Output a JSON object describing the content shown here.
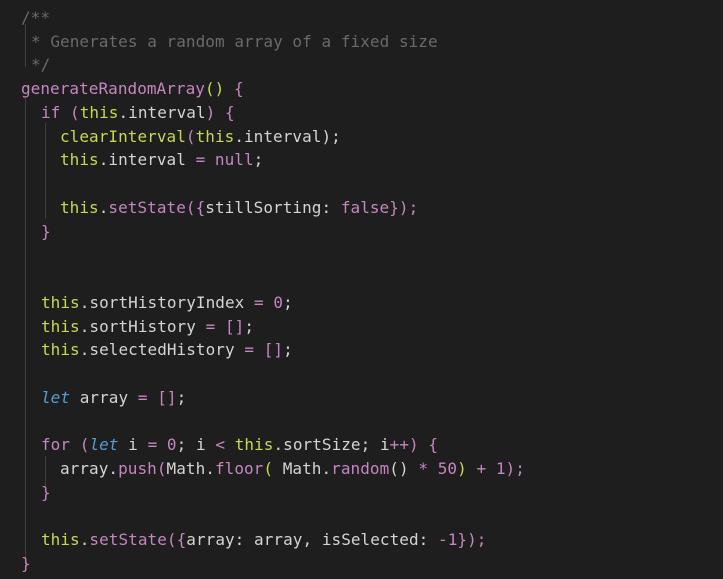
{
  "code": {
    "l1": "/**",
    "l2": "* Generates a random array of a fixed size",
    "l3": "*/",
    "l4_name": "generateRandomArray",
    "l4_parens": "()",
    "l4_brace": " {",
    "l5_if": "if",
    "l5_open": " (",
    "l5_this": "this",
    "l5_dot": ".interval",
    "l5_close": ")",
    "l5_brace": " {",
    "l6_call": "clearInterval",
    "l6_open": "(",
    "l6_this": "this",
    "l6_rest": ".interval",
    "l6_close": ");",
    "l7_this": "this",
    "l7_prop": ".interval ",
    "l7_eq": "=",
    "l7_null": " null",
    "l7_semi": ";",
    "l9_this": "this",
    "l9_dot": ".",
    "l9_call": "setState",
    "l9_open": "({",
    "l9_key": "stillSorting: ",
    "l9_bool": "false",
    "l9_close": "});",
    "l10_brace": "}",
    "l13_this": "this",
    "l13_prop": ".sortHistoryIndex ",
    "l13_eq": "=",
    "l13_num": " 0",
    "l13_semi": ";",
    "l14_this": "this",
    "l14_prop": ".sortHistory ",
    "l14_eq": "=",
    "l14_arr": " []",
    "l14_semi": ";",
    "l15_this": "this",
    "l15_prop": ".selectedHistory ",
    "l15_eq": "=",
    "l15_arr": " []",
    "l15_semi": ";",
    "l17_let": "let",
    "l17_name": " array ",
    "l17_eq": "=",
    "l17_arr": " []",
    "l17_semi": ";",
    "l19_for": "for",
    "l19_open": " (",
    "l19_let": "let",
    "l19_i": " i ",
    "l19_eq": "=",
    "l19_zero": " 0",
    "l19_semi1": "; i ",
    "l19_lt": "<",
    "l19_sp": " ",
    "l19_this": "this",
    "l19_rest": ".sortSize; i",
    "l19_inc": "++",
    "l19_close": ")",
    "l19_brace": " {",
    "l20_arr": "array.",
    "l20_push": "push",
    "l20_open": "(",
    "l20_math": "Math.",
    "l20_floor": "floor",
    "l20_open2": "(",
    "l20_sp": " ",
    "l20_math2": "Math.",
    "l20_random": "random",
    "l20_paren": "()",
    "l20_star": " *",
    "l20_fifty": " 50",
    "l20_close": ")",
    "l20_plus": " +",
    "l20_one": " 1",
    "l20_end": ");",
    "l21_brace": "}",
    "l23_this": "this",
    "l23_dot": ".",
    "l23_call": "setState",
    "l23_open": "({",
    "l23_key": "array: array, isSelected: ",
    "l23_neg": "-1",
    "l23_close": "});",
    "l24_brace": "}"
  },
  "colors": {
    "background": "#1e1e1e",
    "keyword": "#c586c0",
    "this": "#c9d84f",
    "comment": "#6a6a6a",
    "let": "#569cd6",
    "text": "#d4d4d4"
  }
}
